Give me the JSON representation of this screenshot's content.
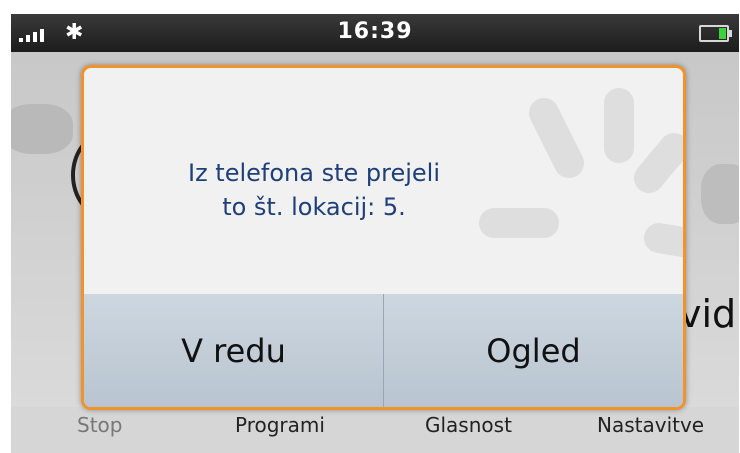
{
  "status": {
    "time": "16:39",
    "bluetooth_symbol": "✱"
  },
  "dialog": {
    "message_line1": "Iz telefona ste prejeli",
    "message_line2": "to št. lokacij: 5.",
    "ok_label": "V redu",
    "view_label": "Ogled"
  },
  "background": {
    "partial_text": "vid"
  },
  "bottom_bar": {
    "items": [
      "Stop",
      "Programi",
      "Glasnost",
      "Nastavitve"
    ]
  },
  "colors": {
    "dialog_border": "#f0932b",
    "message_text": "#1f3f78",
    "battery_fill": "#3dd13d"
  }
}
